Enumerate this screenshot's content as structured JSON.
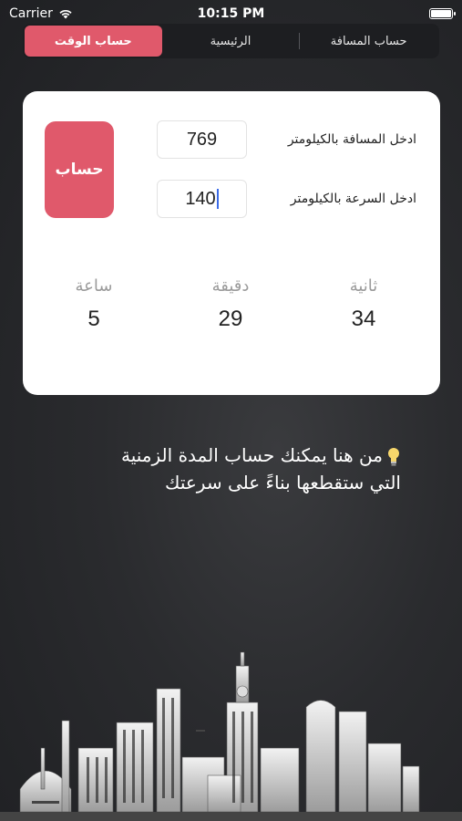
{
  "status": {
    "carrier": "Carrier",
    "time": "10:15 PM"
  },
  "tabs": [
    {
      "label": "حساب المسافة",
      "active": false
    },
    {
      "label": "الرئيسية",
      "active": false
    },
    {
      "label": "حساب الوقت",
      "active": true
    }
  ],
  "form": {
    "distance_label": "ادخل المسافة بالكيلومتر",
    "distance_value": "769",
    "speed_label": "ادخل السرعة بالكيلومتر",
    "speed_value": "140",
    "calculate_label": "حساب"
  },
  "results": {
    "seconds": {
      "label": "ثانية",
      "value": "34"
    },
    "minutes": {
      "label": "دقيقة",
      "value": "29"
    },
    "hours": {
      "label": "ساعة",
      "value": "5"
    }
  },
  "info_text": {
    "line1": "من هنا يمكنك حساب المدة الزمنية",
    "line2": "التي ستقطعها بناءً على سرعتك"
  },
  "icons": {
    "bulb": "lightbulb-icon",
    "wifi": "wifi-icon",
    "battery": "battery-icon"
  },
  "colors": {
    "accent": "#e0596b",
    "background": "#2a2b2e",
    "card": "#ffffff"
  }
}
